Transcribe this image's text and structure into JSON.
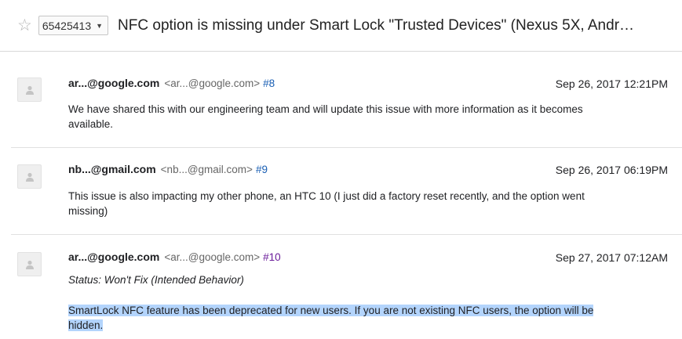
{
  "header": {
    "issue_id": "65425413",
    "title": "NFC option is missing under Smart Lock \"Trusted Devices\" (Nexus 5X, Andr…"
  },
  "comments": [
    {
      "author": "ar...@google.com",
      "email": "<ar...@google.com>",
      "number": "#8",
      "date": "Sep 26, 2017 12:21PM",
      "text": "We have shared this with our engineering team and will update this issue with more information as it becomes available."
    },
    {
      "author": "nb...@gmail.com",
      "email": "<nb...@gmail.com>",
      "number": "#9",
      "date": "Sep 26, 2017 06:19PM",
      "text": "This issue is also impacting my other phone, an HTC 10 (I just did a factory reset recently, and the option went missing)"
    },
    {
      "author": "ar...@google.com",
      "email": "<ar...@google.com>",
      "number": "#10",
      "date": "Sep 27, 2017 07:12AM",
      "status": "Status: Won't Fix (Intended Behavior)",
      "text": "SmartLock NFC feature has been deprecated for new users. If you are not existing NFC users, the option will be hidden."
    }
  ]
}
